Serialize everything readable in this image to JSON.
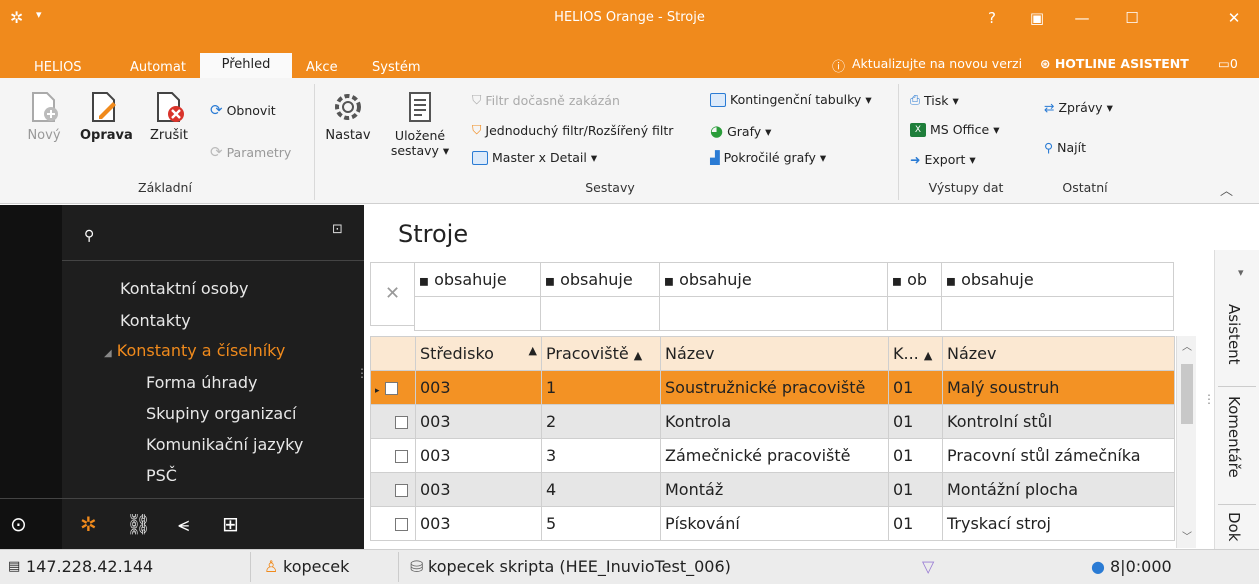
{
  "window": {
    "title": "HELIOS Orange - Stroje"
  },
  "menu": {
    "items": [
      "HELIOS",
      "Automat",
      "Přehled",
      "Akce",
      "Systém"
    ],
    "update": "Aktualizujte na novou verzi",
    "hotline": "HOTLINE ASISTENT",
    "msg_count": "0"
  },
  "ribbon": {
    "novy": "Nový",
    "oprava": "Oprava",
    "zrusit": "Zrušit",
    "obnovit": "Obnovit",
    "parametry": "Parametry",
    "zakladni": "Základní",
    "nastav": "Nastav",
    "ulozene": "Uložené",
    "sestavy": "sestavy",
    "filtr_zakazan": "Filtr dočasně zakázán",
    "jednoduchy_filtr": "Jednoduchý filtr/Rozšířený filtr",
    "master_detail": "Master x Detail",
    "kontingencni": "Kontingenční tabulky",
    "grafy": "Grafy",
    "pokrocile": "Pokročilé grafy",
    "sestavy_grp": "Sestavy",
    "tisk": "Tisk",
    "ms_office": "MS Office",
    "export": "Export",
    "vystupy": "Výstupy dat",
    "zpravy": "Zprávy",
    "najit": "Najít",
    "ostatni": "Ostatní"
  },
  "nav": {
    "items": [
      "Kontaktní osoby",
      "Kontakty",
      "Konstanty a číselníky",
      "Forma úhrady",
      "Skupiny organizací",
      "Komunikační jazyky",
      "PSČ"
    ]
  },
  "page": {
    "title": "Stroje"
  },
  "filter": {
    "labels": [
      "obsahuje",
      "obsahuje",
      "obsahuje",
      "ob",
      "obsahuje"
    ]
  },
  "grid": {
    "headers": [
      "Středisko",
      "Pracoviště",
      "Název",
      "K...",
      "Název"
    ],
    "rows": [
      [
        "003",
        "1",
        "Soustružnické pracoviště",
        "01",
        "Malý soustruh"
      ],
      [
        "003",
        "2",
        "Kontrola",
        "01",
        "Kontrolní stůl"
      ],
      [
        "003",
        "3",
        "Zámečnické pracoviště",
        "01",
        "Pracovní stůl zámečníka"
      ],
      [
        "003",
        "4",
        "Montáž",
        "01",
        "Montážní plocha"
      ],
      [
        "003",
        "5",
        "Pískování",
        "01",
        "Tryskací stroj"
      ]
    ]
  },
  "sidetabs": [
    "Asistent",
    "Komentáře",
    "Dok"
  ],
  "status": {
    "ip": "147.228.42.144",
    "user": "kopecek",
    "db": "kopecek skripta (HEE_InuvioTest_006)",
    "counter": "8|0:000"
  },
  "colors": {
    "accent": "#f08a1c",
    "selected_row": "#f39224"
  }
}
